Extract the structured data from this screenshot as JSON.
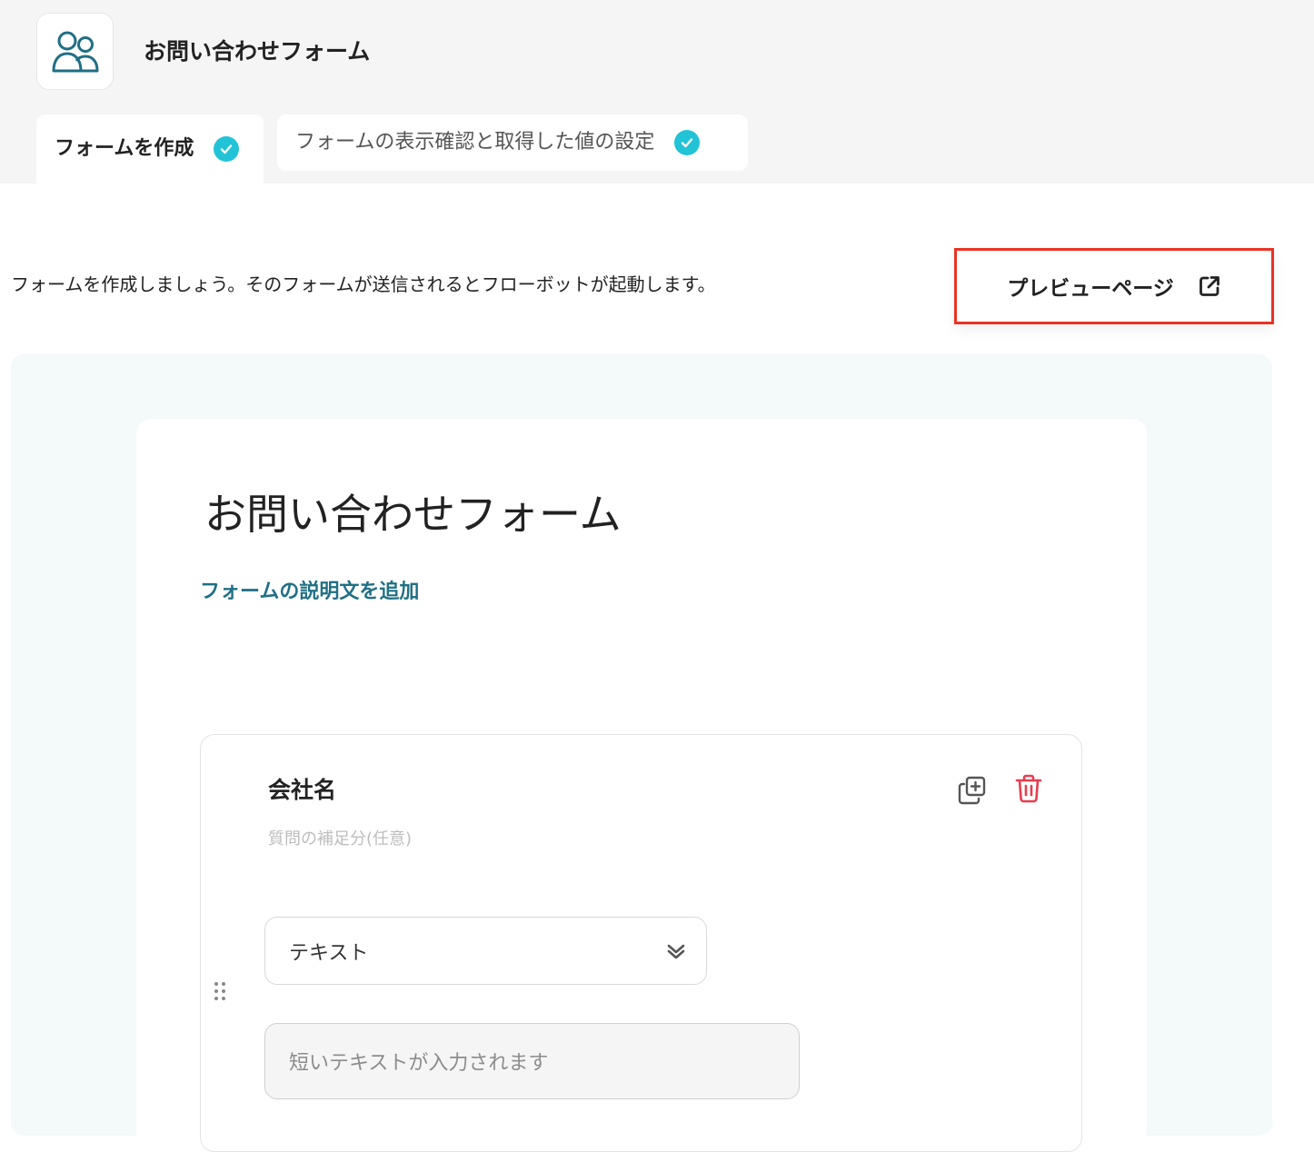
{
  "header": {
    "app_icon": "users-icon",
    "title": "お問い合わせフォーム"
  },
  "tabs": [
    {
      "label": "フォームを作成",
      "completed": true,
      "icon": "check-circle-icon"
    },
    {
      "label": "フォームの表示確認と取得した値の設定",
      "completed": true,
      "icon": "check-circle-icon"
    }
  ],
  "intro_text": "フォームを作成しましょう。そのフォームが送信されるとフローボットが起動します。",
  "preview_button": {
    "label": "プレビューページ",
    "icon": "external-link-icon"
  },
  "form": {
    "title": "お問い合わせフォーム",
    "add_description_link": "フォームの説明文を追加",
    "question": {
      "label": "会社名",
      "help_placeholder": "質問の補足分(任意)",
      "type_value": "テキスト",
      "answer_placeholder": "短いテキストが入力されます",
      "icons": [
        "duplicate-icon",
        "trash-icon",
        "chevron-down-icon",
        "drag-handle-icon"
      ]
    }
  },
  "colors": {
    "accent_check": "#22c3d6",
    "link": "#1f6f85",
    "highlight_border": "#ea3323",
    "delete": "#e53e4f",
    "canvas_bg": "#f3faf9"
  }
}
